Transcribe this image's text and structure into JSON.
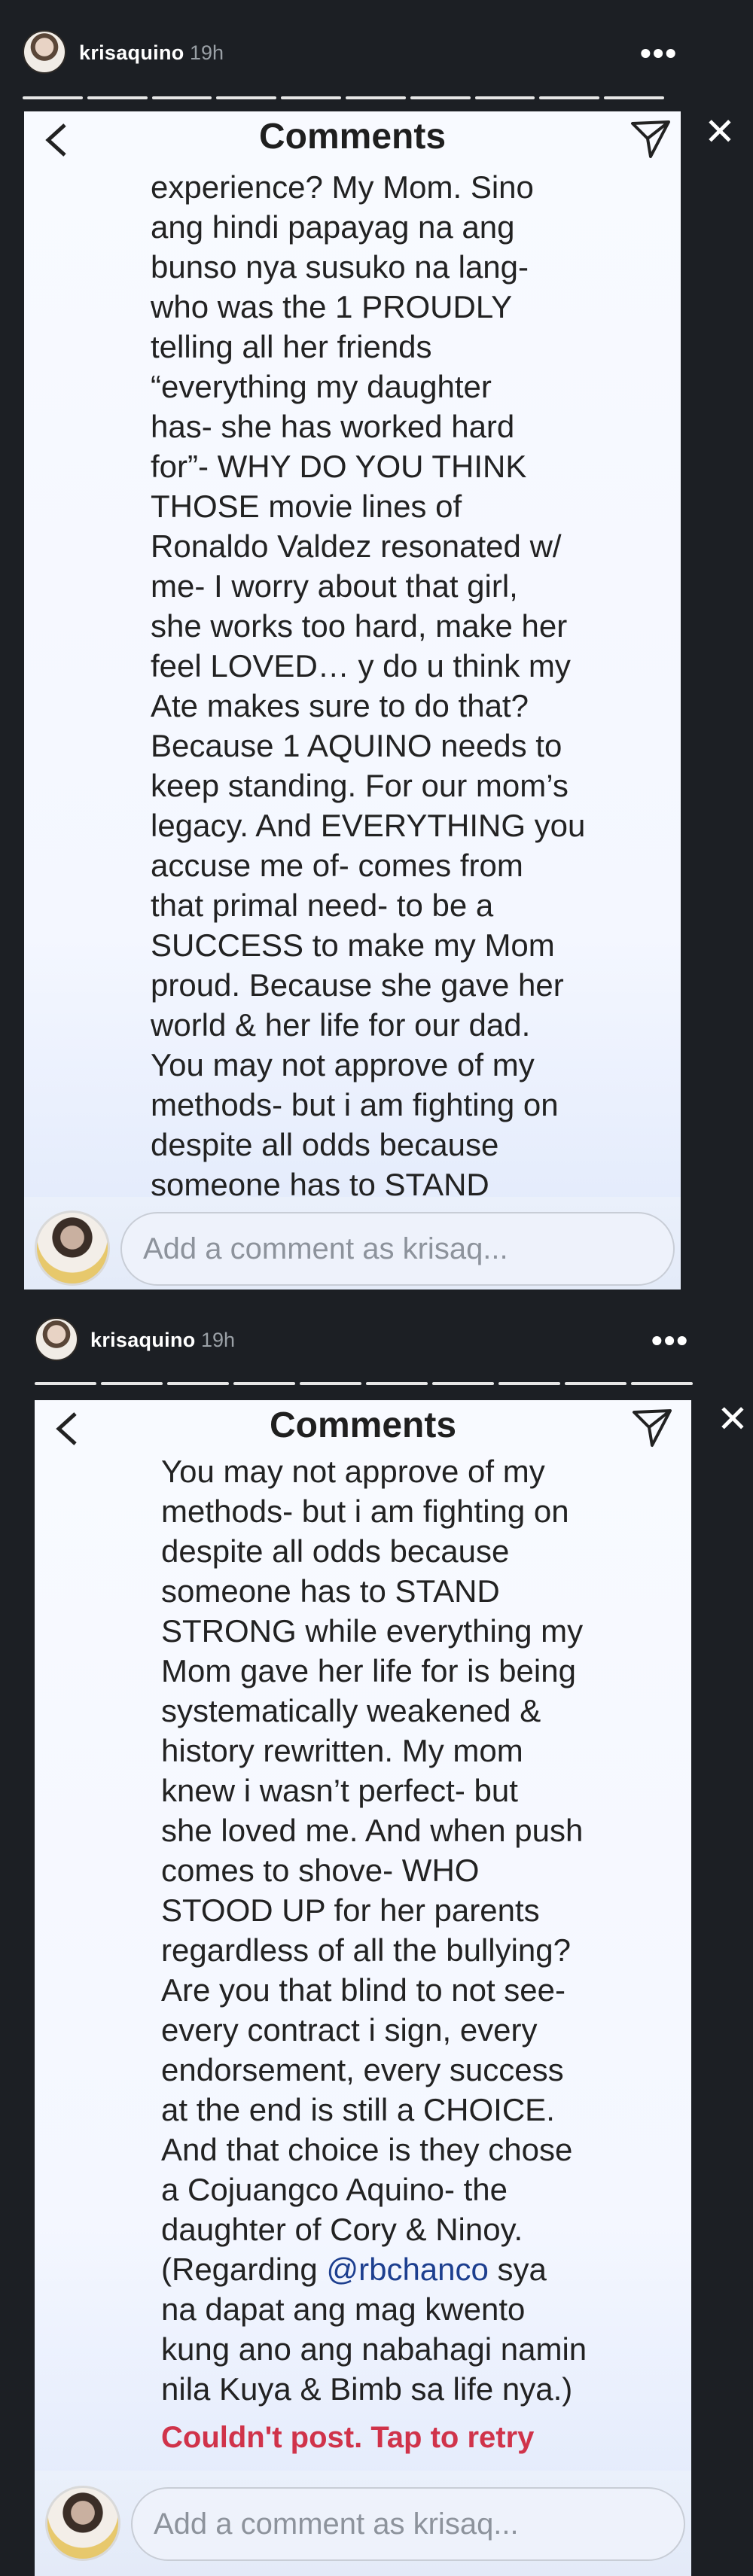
{
  "stories": [
    {
      "username": "krisaquino",
      "time": "19h",
      "more_label": "•••",
      "close_label": "✕",
      "panel_title": "Comments",
      "caption": "experience? My Mom. Sino\nang hindi papayag na ang\nbunso nya susuko na lang-\nwho was the 1 PROUDLY\ntelling all her friends\n“everything my daughter\nhas- she has worked hard\nfor”- WHY DO YOU THINK\nTHOSE movie lines of\nRonaldo Valdez resonated w/\nme- I worry about that girl,\nshe works too hard, make her\nfeel LOVED… y do u think my\nAte makes sure to do that?\nBecause 1 AQUINO needs to\nkeep standing. For our mom’s\nlegacy. And EVERYTHING you\naccuse me of- comes from\nthat primal need- to be a\nSUCCESS to make my Mom\nproud. Because she gave her\nworld & her life for our dad.\nYou may not approve of my\nmethods- but i am fighting on\ndespite all odds because\nsomeone has to STAND",
      "comment_placeholder": "Add a comment as krisaq...",
      "icons": {
        "back": "chevron-left-icon",
        "send": "paper-plane-icon",
        "more": "more-dots-icon",
        "close": "close-icon"
      }
    },
    {
      "username": "krisaquino",
      "time": "19h",
      "more_label": "•••",
      "close_label": "✕",
      "panel_title": "Comments",
      "caption_main": "You may not approve of my\nmethods- but i am fighting on\ndespite all odds because\nsomeone has to STAND\nSTRONG while everything my\nMom gave her life for is being\nsystematically weakened &\nhistory rewritten. My mom\nknew i wasn’t perfect- but\nshe loved me. And when push\ncomes to shove- WHO\nSTOOD UP for her parents\nregardless of all the bullying?\nAre you that blind to not see-\nevery contract i sign, every\nendorsement, every success\nat the end is still a CHOICE.\nAnd that choice is they chose\na Cojuangco Aquino- the\ndaughter of Cory & Ninoy.\n(Regarding ",
      "mention": "@rbchanco",
      "caption_tail": " sya\nna dapat ang mag kwento\nkung ano ang nabahagi namin\nnila Kuya & Bimb sa life nya.)",
      "error": "Couldn't post. Tap to retry",
      "comment_placeholder": "Add a comment as krisaq...",
      "icons": {
        "back": "chevron-left-icon",
        "send": "paper-plane-icon",
        "more": "more-dots-icon",
        "close": "close-icon"
      }
    }
  ],
  "colors": {
    "background": "#1c1f24",
    "error": "#d0334a",
    "mention": "#1d3f8f",
    "panel": "#f4f7ff"
  }
}
